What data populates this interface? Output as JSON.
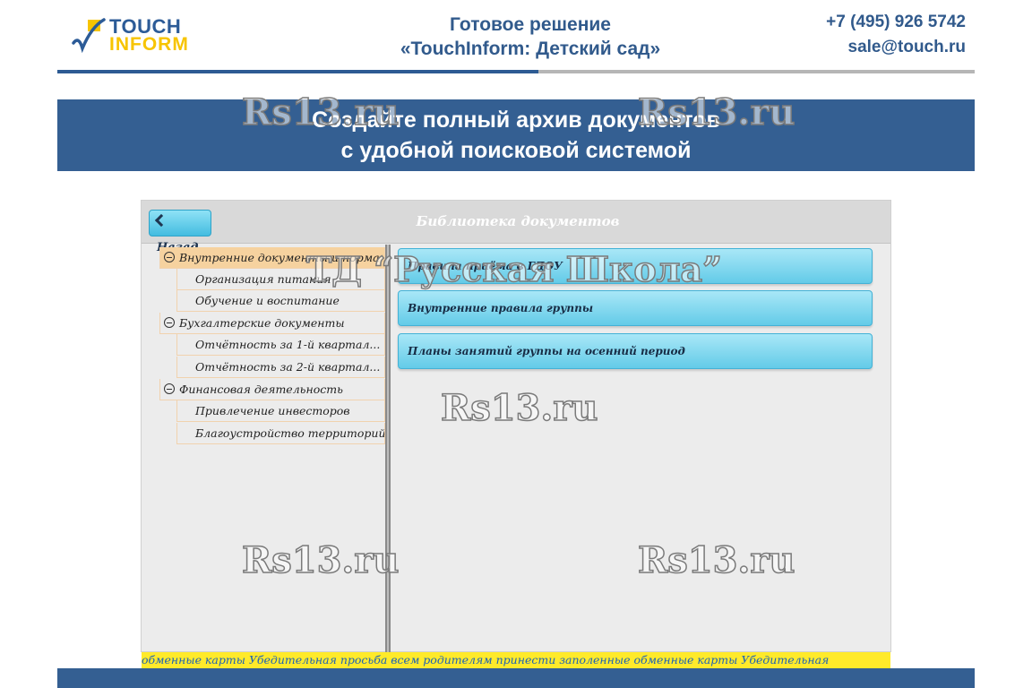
{
  "logo": {
    "line1": "TOUCH",
    "line2": "INFORM"
  },
  "header": {
    "title_line1": "Готовое решение",
    "title_line2": "«TouchInform: Детский сад»",
    "phone": "+7 (495) 926 5742",
    "email": "sale@touch.ru"
  },
  "banner": {
    "line1": "Создайте полный архив документов",
    "line2": "с удобной поисковой системой"
  },
  "app": {
    "back_label": "Назад",
    "title": "Библиотека документов",
    "tree": [
      {
        "label": "Внутренние документы и норма...",
        "level": 0,
        "selected": true
      },
      {
        "label": "Организация питания",
        "level": 1
      },
      {
        "label": "Обучение и воспитание",
        "level": 1
      },
      {
        "label": "Бухгалтерские документы",
        "level": 0
      },
      {
        "label": "Отчётность за 1-й квартал...",
        "level": 1
      },
      {
        "label": "Отчётность за 2-й квартал...",
        "level": 1
      },
      {
        "label": "Финансовая деятельность",
        "level": 0
      },
      {
        "label": "Привлечение инвесторов",
        "level": 1
      },
      {
        "label": "Благоустройство территорий",
        "level": 1
      }
    ],
    "documents": [
      {
        "label": "Правила приёма в ГДОУ"
      },
      {
        "label": "Внутренние правила группы"
      },
      {
        "label": "Планы занятий группы на осенний период"
      }
    ],
    "ticker": "обменные карты  Убедительная просьба всем родителям принести заполенные обменные карты  Убедительная"
  },
  "watermarks": {
    "site": "Rs13.ru",
    "school": "ТД “Русская Школа”"
  },
  "colors": {
    "brand_blue": "#345f92",
    "logo_yellow": "#f7c400",
    "button_cyan": "#63cbe8",
    "selection_orange": "#f6d29f",
    "ticker_yellow": "#ffea2a"
  }
}
